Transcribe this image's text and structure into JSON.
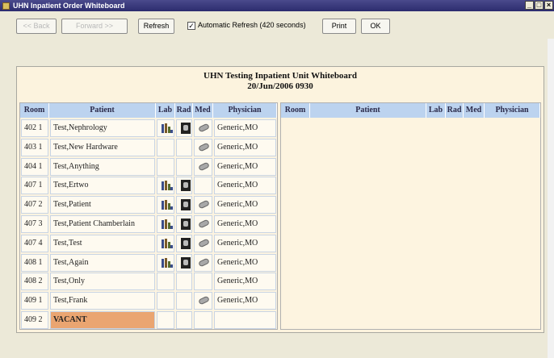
{
  "window": {
    "title": "UHN Inpatient Order Whiteboard"
  },
  "toolbar": {
    "back_label": "<< Back",
    "forward_label": "Forward >>",
    "refresh_label": "Refresh",
    "auto_refresh_label": "Automatic Refresh (420 seconds)",
    "auto_refresh_checked": true,
    "print_label": "Print",
    "ok_label": "OK"
  },
  "board": {
    "title": "UHN Testing Inpatient Unit Whiteboard",
    "datetime": "20/Jun/2006 0930"
  },
  "columns": [
    "Room",
    "Patient",
    "Lab",
    "Rad",
    "Med",
    "Physician"
  ],
  "rows": [
    {
      "room": "402 1",
      "patient": "Test,Nephrology",
      "lab": true,
      "rad": true,
      "med": true,
      "physician": "Generic,MO",
      "vacant": false
    },
    {
      "room": "403 1",
      "patient": "Test,New Hardware",
      "lab": false,
      "rad": false,
      "med": true,
      "physician": "Generic,MO",
      "vacant": false
    },
    {
      "room": "404 1",
      "patient": "Test,Anything",
      "lab": false,
      "rad": false,
      "med": true,
      "physician": "Generic,MO",
      "vacant": false
    },
    {
      "room": "407 1",
      "patient": "Test,Ertwo",
      "lab": true,
      "rad": true,
      "med": false,
      "physician": "Generic,MO",
      "vacant": false
    },
    {
      "room": "407 2",
      "patient": "Test,Patient",
      "lab": true,
      "rad": true,
      "med": true,
      "physician": "Generic,MO",
      "vacant": false
    },
    {
      "room": "407 3",
      "patient": "Test,Patient Chamberlain",
      "lab": true,
      "rad": true,
      "med": true,
      "physician": "Generic,MO",
      "vacant": false
    },
    {
      "room": "407 4",
      "patient": "Test,Test",
      "lab": true,
      "rad": true,
      "med": true,
      "physician": "Generic,MO",
      "vacant": false
    },
    {
      "room": "408 1",
      "patient": "Test,Again",
      "lab": true,
      "rad": true,
      "med": true,
      "physician": "Generic,MO",
      "vacant": false
    },
    {
      "room": "408 2",
      "patient": "Test,Only",
      "lab": false,
      "rad": false,
      "med": false,
      "physician": "Generic,MO",
      "vacant": false
    },
    {
      "room": "409 1",
      "patient": "Test,Frank",
      "lab": false,
      "rad": false,
      "med": true,
      "physician": "Generic,MO",
      "vacant": false
    },
    {
      "room": "409 2",
      "patient": "VACANT",
      "lab": false,
      "rad": false,
      "med": false,
      "physician": "",
      "vacant": true
    }
  ],
  "right_columns": [
    "Room",
    "Patient",
    "Lab",
    "Rad",
    "Med",
    "Physician"
  ],
  "icons": {
    "lab": "lab-icon",
    "rad": "xray-icon",
    "med": "pill-icon"
  },
  "colors": {
    "vacant": "#eaa571",
    "header": "#bcd3ef",
    "titlebar": "#2c2c6e"
  }
}
